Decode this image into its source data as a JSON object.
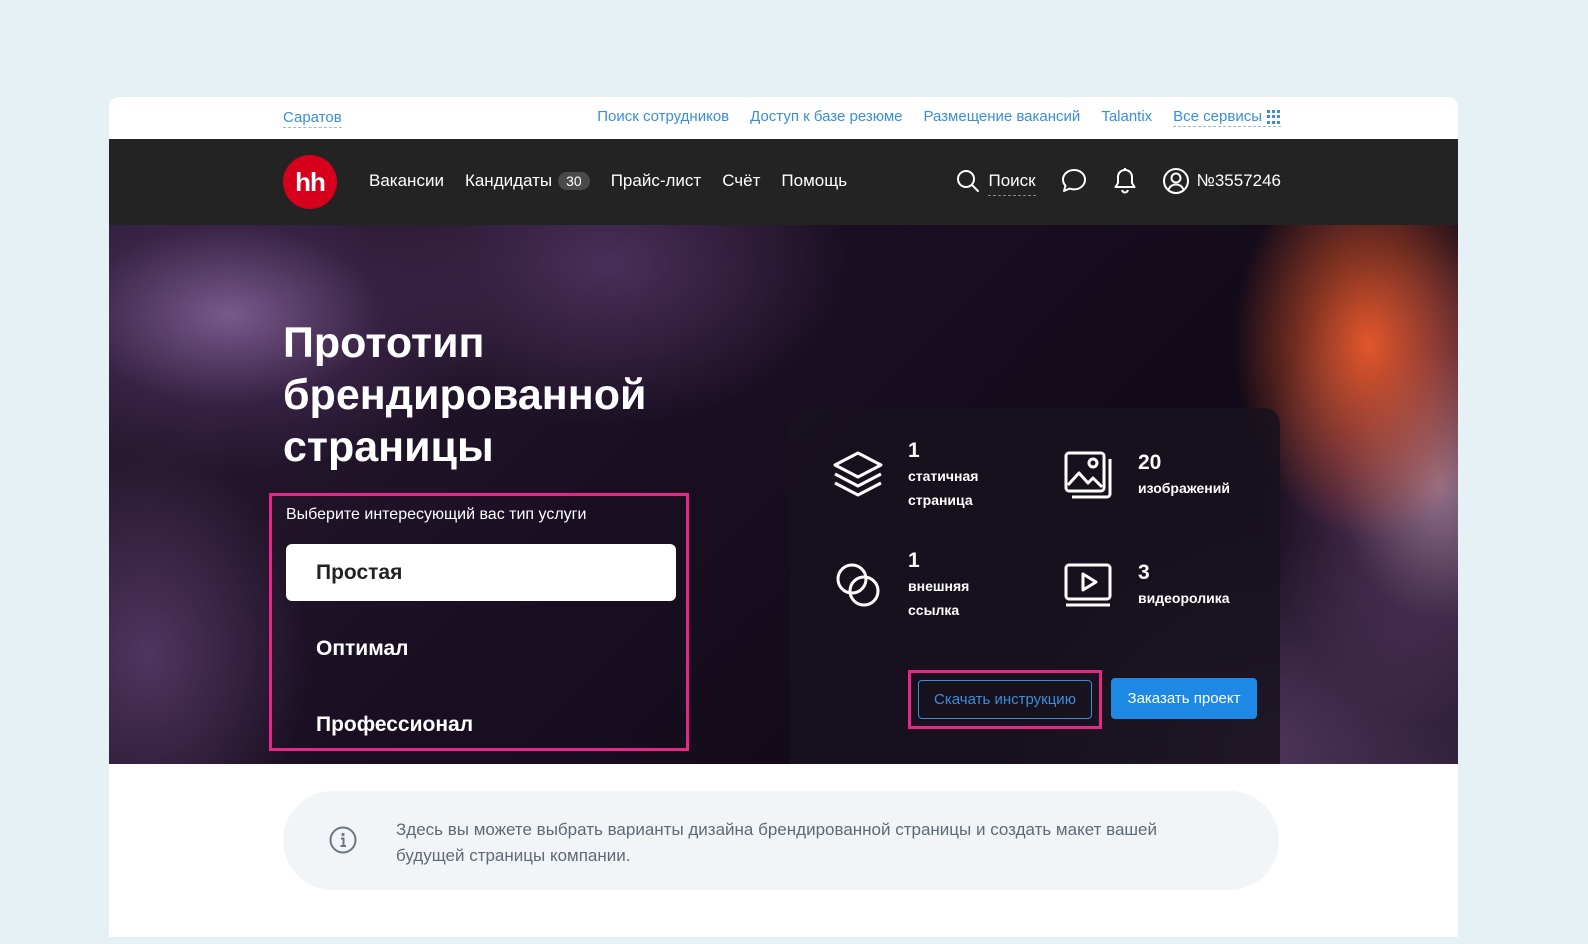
{
  "top_links": {
    "city": "Саратов",
    "links": [
      "Поиск сотрудников",
      "Доступ к базе резюме",
      "Размещение вакансий",
      "Talantix"
    ],
    "all_services": "Все сервисы"
  },
  "nav": {
    "logo_text": "hh",
    "items": [
      "Вакансии",
      "Кандидаты",
      "Прайс-лист",
      "Счёт",
      "Помощь"
    ],
    "candidates_badge": "30",
    "search_label": "Поиск",
    "profile_label": "№3557246"
  },
  "hero": {
    "title": "Прототип брендированной страницы",
    "service_prompt": "Выберите интересующий вас тип услуги",
    "options": [
      "Простая",
      "Оптимал",
      "Профессионал"
    ],
    "selected_option": "Простая"
  },
  "features": [
    {
      "icon": "layers-icon",
      "number": "1",
      "label_line1": "статичная",
      "label_line2": "страница"
    },
    {
      "icon": "image-icon",
      "number": "20",
      "label_line1": "изображений",
      "label_line2": ""
    },
    {
      "icon": "link-circles-icon",
      "number": "1",
      "label_line1": "внешняя",
      "label_line2": "ссылка"
    },
    {
      "icon": "video-icon",
      "number": "3",
      "label_line1": "видеоролика",
      "label_line2": ""
    }
  ],
  "actions": {
    "download_label": "Скачать инструкцию",
    "order_label": "Заказать проект"
  },
  "banner": {
    "text": "Здесь вы можете выбрать варианты дизайна брендированной страницы и создать макет вашей будущей страницы компании."
  },
  "colors": {
    "brand_red": "#d6001c",
    "link_blue": "#3a8ed8",
    "button_blue": "#1e88e5",
    "highlight_pink": "#e8268a",
    "nav_bg": "#232323"
  }
}
